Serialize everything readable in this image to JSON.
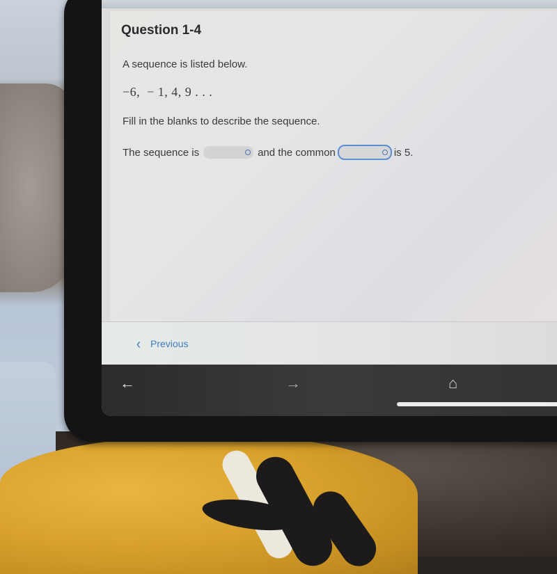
{
  "question": {
    "title": "Question 1-4",
    "prompt": "A sequence is listed below.",
    "sequence": "−6,  − 1, 4, 9 . . .",
    "instruction": "Fill in the blanks to describe the sequence.",
    "answer_line": {
      "part1": "The sequence is",
      "dropdown1_value": "",
      "part2": "and the common",
      "dropdown2_value": "",
      "part3": "is 5."
    }
  },
  "footer": {
    "previous_label": "Previous"
  },
  "nav_bar": {
    "back_icon": "←",
    "forward_icon": "→",
    "home_icon": "⌂"
  },
  "colors": {
    "accent": "#3f7bc4",
    "focus_ring": "#5b8ed1"
  }
}
